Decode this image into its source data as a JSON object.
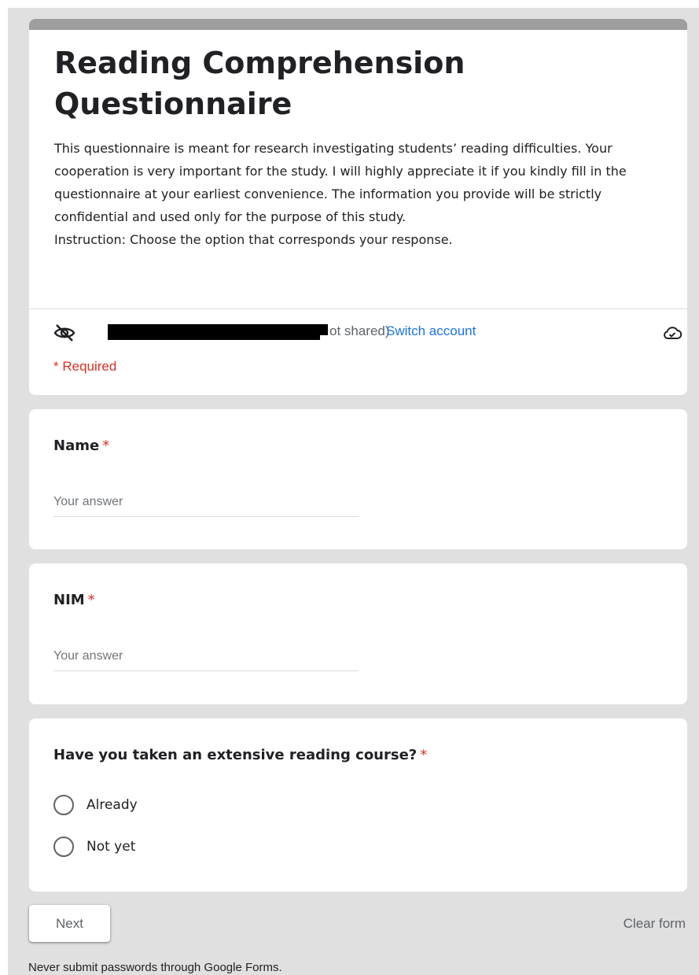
{
  "form": {
    "title": "Reading Comprehension Questionnaire",
    "description": [
      "This questionnaire is meant for research investigating students’ reading difficulties. Your cooperation is very important for the study. I will highly appreciate it if you kindly fill in the questionnaire at your earliest convenience. The information you provide will be strictly confidential and used only for the purpose of this study.",
      "Instruction: Choose the option that corresponds your response."
    ],
    "theme_color": "#9e9e9e"
  },
  "account": {
    "visible_text": "ot shared)",
    "switch_label": "Switch account",
    "hidden_icon": "eye-off-icon",
    "save_icon": "cloud-check-icon"
  },
  "required_note": "* Required",
  "questions": [
    {
      "title": "Name",
      "required_mark": "*",
      "placeholder": "Your answer"
    },
    {
      "title": "NIM",
      "required_mark": "*",
      "placeholder": "Your answer"
    },
    {
      "title": "Have you taken an extensive reading course?",
      "required_mark": "*",
      "options": [
        "Already",
        "Not yet"
      ]
    }
  ],
  "navigation": {
    "next_label": "Next",
    "clear_label": "Clear form"
  },
  "footer": {
    "note": "Never submit passwords through Google Forms."
  },
  "colors": {
    "background": "#e0e0e0",
    "card": "#ffffff",
    "required": "#d93025",
    "link": "#1a73e8"
  }
}
